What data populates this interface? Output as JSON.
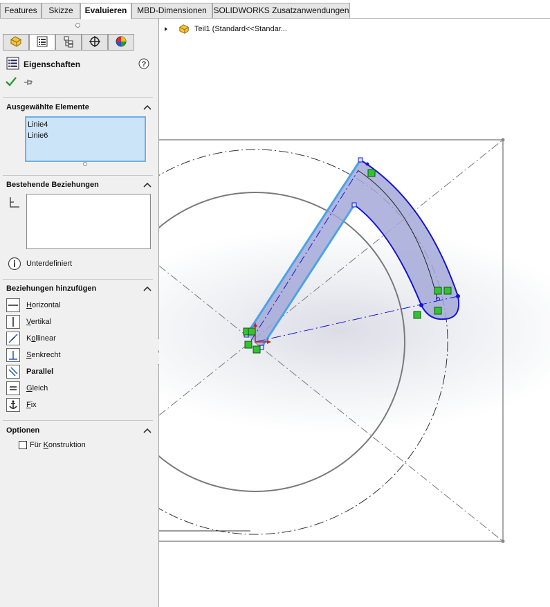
{
  "tabs": [
    {
      "label": "Features",
      "active": false
    },
    {
      "label": "Skizze",
      "active": false
    },
    {
      "label": "Evaluieren",
      "active": true
    },
    {
      "label": "MBD-Dimensionen",
      "active": false
    },
    {
      "label": "SOLIDWORKS Zusatzanwendungen",
      "active": false
    }
  ],
  "panel": {
    "title": "Eigenschaften",
    "help_icon": "help-icon",
    "ok_icon": "checkmark-icon",
    "pin_icon": "pushpin-icon",
    "selected": {
      "title": "Ausgewählte Elemente",
      "items": [
        "Linie4",
        "Linie6"
      ]
    },
    "existing": {
      "title": "Bestehende Beziehungen",
      "status": "Unterdefiniert"
    },
    "add": {
      "title": "Beziehungen hinzufügen",
      "items": [
        {
          "label": "Horizontal",
          "mnemonic": "H",
          "rest": "orizontal",
          "bold": false
        },
        {
          "label": "Vertikal",
          "mnemonic": "V",
          "rest": "ertikal",
          "bold": false
        },
        {
          "label": "Kollinear",
          "pre": "K",
          "mnemonic": "o",
          "rest": "llinear",
          "bold": false
        },
        {
          "label": "Senkrecht",
          "mnemonic": "S",
          "rest": "enkrecht",
          "bold": false
        },
        {
          "label": "Parallel",
          "mnemonic": "",
          "rest": "Parallel",
          "bold": true
        },
        {
          "label": "Gleich",
          "mnemonic": "G",
          "rest": "leich",
          "bold": false
        },
        {
          "label": "Fix",
          "mnemonic": "F",
          "rest": "ix",
          "bold": false
        }
      ]
    },
    "options": {
      "title": "Optionen",
      "construction_pre": "Für ",
      "construction_mnemonic": "K",
      "construction_rest": "onstruktion",
      "construction_checked": false
    }
  },
  "tree": {
    "label": "Teil1  (Standard<<Standar..."
  },
  "colors": {
    "selection_fill": "#a4a9d8",
    "selection_edge": "#1414d2",
    "highlight_edge": "#4aa3e8",
    "relation_green": "#31c431",
    "list_bg": "#cce4f7"
  }
}
